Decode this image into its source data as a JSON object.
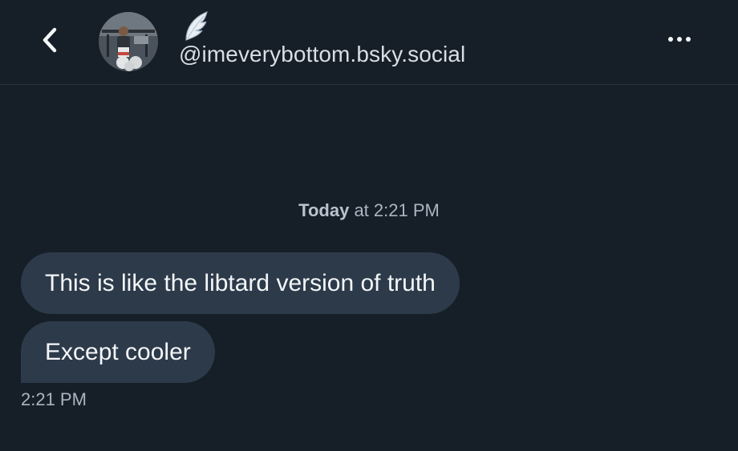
{
  "header": {
    "handle": "@imeverybottom.bsky.social",
    "icons": {
      "back": "chevron-left-icon",
      "more": "more-horizontal-icon",
      "wing": "wing-emoji"
    }
  },
  "conversation": {
    "date_separator": {
      "day": "Today",
      "rest": "at 2:21 PM"
    },
    "messages": [
      {
        "text": "This is like the libtard version of truth"
      },
      {
        "text": "Except cooler"
      }
    ],
    "last_timestamp": "2:21 PM"
  },
  "colors": {
    "background": "#161e27",
    "bubble": "#2c3a4a",
    "muted_text": "#aab5c2"
  }
}
